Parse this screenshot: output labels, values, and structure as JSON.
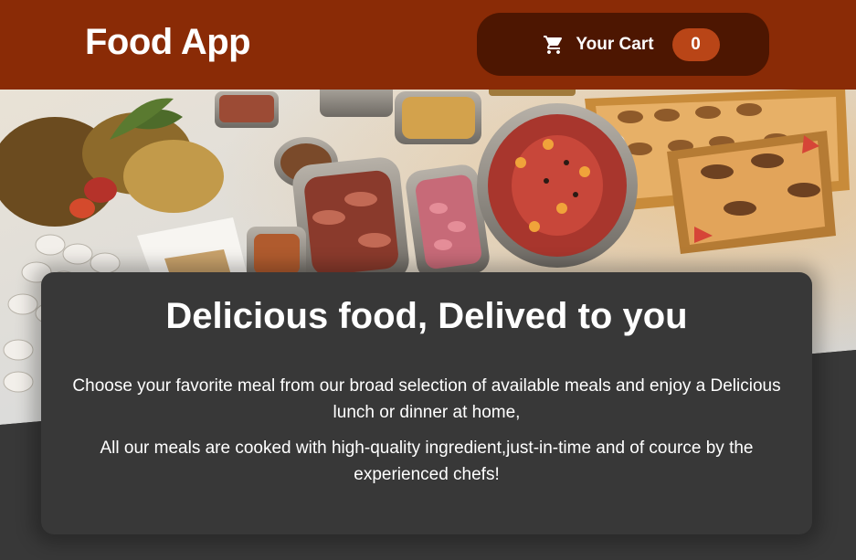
{
  "header": {
    "logo_text": "Food App",
    "cart": {
      "icon": "shopping-cart-icon",
      "label": "Your Cart",
      "count": "0"
    }
  },
  "hero": {
    "image": "food-buffet-photo"
  },
  "summary": {
    "title": "Delicious food, Delived to you",
    "paragraph_1": "Choose your favorite meal from our broad selection of available meals and enjoy a Delicious lunch or dinner at home,",
    "paragraph_2": "All our meals are cooked with high-quality ingredient,just-in-time and of cource by the experienced chefs!"
  },
  "colors": {
    "header_bg": "#8a2b06",
    "cart_bg": "#4d1601",
    "badge_bg": "#b94517",
    "card_bg": "#383838",
    "page_bg": "#383838"
  }
}
